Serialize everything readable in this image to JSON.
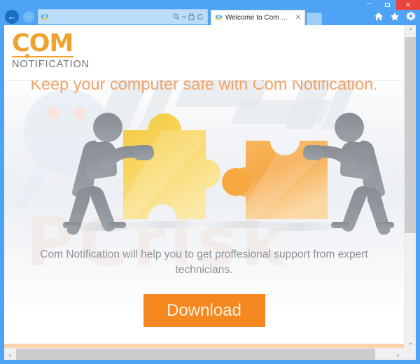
{
  "browser": {
    "window_controls": {
      "minimize_label": "–",
      "maximize_label": "",
      "close_label": "✕"
    },
    "back_label": "←",
    "forward_label": "→",
    "address_value": "",
    "address_placeholder": "",
    "search_icon": "search-icon",
    "dropdown_icon": "chevron-down-icon",
    "compat_icon": "compatibility-view-icon",
    "refresh_icon": "refresh-icon",
    "favicon": "internet-explorer-icon",
    "tab_title": "Welcome to Com Notification",
    "tab_close_label": "✕",
    "home_icon": "home-icon",
    "favorites_icon": "star-icon",
    "settings_icon": "gear-icon",
    "scroll": {
      "up_label": "⌃",
      "down_label": "⌄",
      "left_label": "‹",
      "right_label": "›"
    }
  },
  "page": {
    "logo": {
      "primary": "COM",
      "secondary": "NOTIFICATION",
      "color": "#efa32c"
    },
    "headline": "Keep your computer safe with Com Notification.",
    "headline_color": "#f0a368",
    "subtext": "Com Notification will help you to get proffesional support from expert technicians.",
    "subtext_color": "#8d9196",
    "download_button": "Download",
    "download_button_color": "#f58820",
    "watermark_text": "PCrisk",
    "illustration": {
      "left_piece_color": "#f7d15a",
      "right_piece_color": "#f6ac4e",
      "figure_color": "#8b9196",
      "left_figure": "person-pushing-puzzle-left",
      "right_figure": "person-pushing-puzzle-right"
    }
  }
}
